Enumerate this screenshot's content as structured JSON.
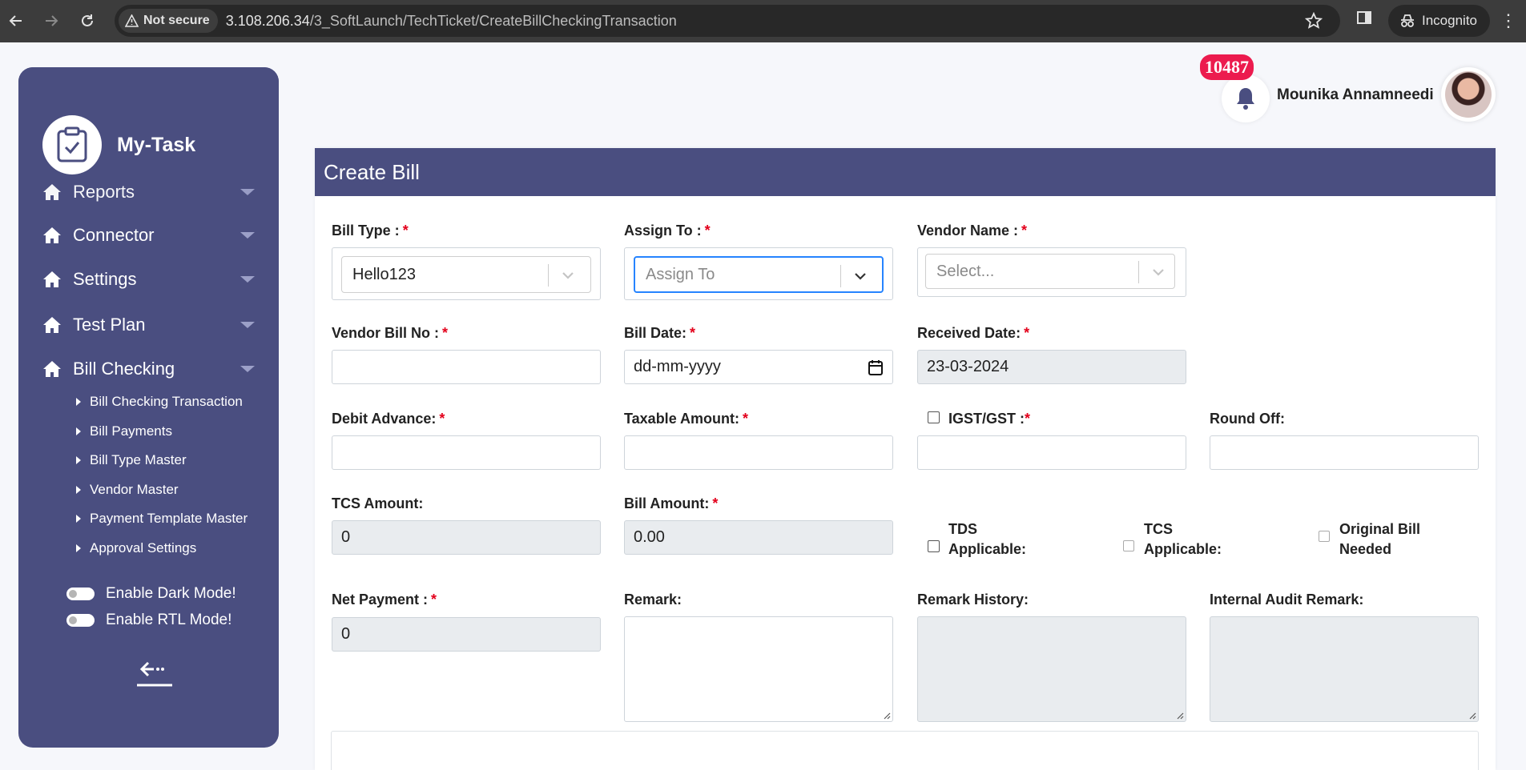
{
  "browser": {
    "security_label": "Not secure",
    "url_host": "3.108.206.34",
    "url_path": "/3_SoftLaunch/TechTicket/CreateBillCheckingTransaction",
    "incognito_label": "Incognito"
  },
  "sidebar": {
    "brand": "My-Task",
    "menu": [
      {
        "label": "Reports"
      },
      {
        "label": "Connector"
      },
      {
        "label": "Settings"
      },
      {
        "label": "Test Plan"
      },
      {
        "label": "Bill Checking"
      }
    ],
    "submenu": [
      {
        "label": "Bill Checking Transaction"
      },
      {
        "label": "Bill Payments"
      },
      {
        "label": "Bill Type Master"
      },
      {
        "label": "Vendor Master"
      },
      {
        "label": "Payment Template Master"
      },
      {
        "label": "Approval Settings"
      }
    ],
    "dark_mode_label": "Enable Dark Mode!",
    "rtl_mode_label": "Enable RTL Mode!"
  },
  "header": {
    "notification_count": "10487",
    "user_name": "Mounika Annamneedi"
  },
  "form": {
    "title": "Create Bill",
    "required_mark": "*",
    "bill_type": {
      "label": "Bill Type :",
      "value": "Hello123"
    },
    "assign_to": {
      "label": "Assign To :",
      "placeholder": "Assign To"
    },
    "vendor_name": {
      "label": "Vendor Name :",
      "placeholder": "Select..."
    },
    "vendor_bill_no": {
      "label": "Vendor Bill No :",
      "value": ""
    },
    "bill_date": {
      "label": "Bill Date:",
      "placeholder": "dd-mm-yyyy"
    },
    "received_date": {
      "label": "Received Date:",
      "value": "23-03-2024"
    },
    "debit_advance": {
      "label": "Debit Advance:",
      "value": ""
    },
    "taxable_amount": {
      "label": "Taxable Amount:",
      "value": ""
    },
    "igst_gst": {
      "label": "IGST/GST :",
      "checked": false,
      "value": ""
    },
    "round_off": {
      "label": "Round Off:",
      "value": ""
    },
    "tcs_amount": {
      "label": "TCS Amount:",
      "value": "0"
    },
    "bill_amount": {
      "label": "Bill Amount:",
      "value": "0.00"
    },
    "tds_applicable": {
      "label_line1": "TDS",
      "label_line2": "Applicable:",
      "checked": false
    },
    "tcs_applicable": {
      "label_line1": "TCS",
      "label_line2": "Applicable:",
      "checked": false
    },
    "original_bill_needed": {
      "label_line1": "Original Bill",
      "label_line2": "Needed",
      "checked": false
    },
    "net_payment": {
      "label": "Net Payment :",
      "value": "0"
    },
    "remark": {
      "label": "Remark:",
      "value": ""
    },
    "remark_history": {
      "label": "Remark History:",
      "value": ""
    },
    "internal_audit_remark": {
      "label": "Internal Audit Remark:",
      "value": ""
    }
  },
  "colors": {
    "sidebar_bg": "#4a4e80",
    "card_header_bg": "#4a4e80",
    "required": "#e3001b",
    "badge_bg": "#ec1b4e",
    "focus_border": "#2684ff"
  }
}
